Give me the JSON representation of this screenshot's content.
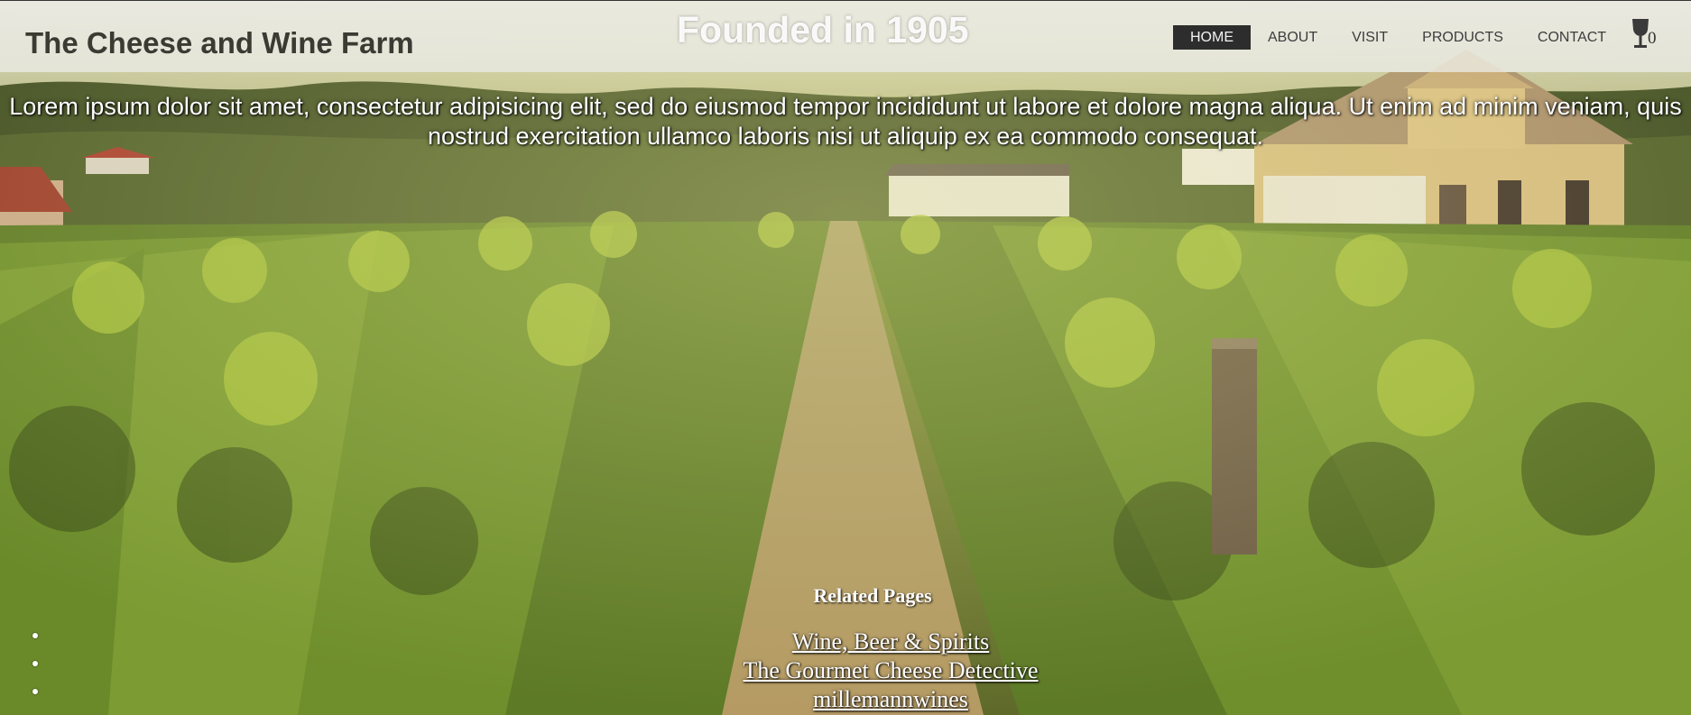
{
  "header": {
    "site_title": "The Cheese and Wine Farm",
    "tagline": "Founded in 1905",
    "nav": [
      {
        "label": "HOME",
        "active": true
      },
      {
        "label": "ABOUT",
        "active": false
      },
      {
        "label": "VISIT",
        "active": false
      },
      {
        "label": "PRODUCTS",
        "active": false
      },
      {
        "label": "CONTACT",
        "active": false
      }
    ],
    "cart": {
      "icon": "wine-glass-icon",
      "count": "0"
    }
  },
  "intro": {
    "text": "Lorem ipsum dolor sit amet, consectetur adipisicing elit, sed do eiusmod tempor incididunt ut labore et dolore magna aliqua. Ut enim ad minim veniam, quis nostrud exercitation ullamco laboris nisi ut aliquip ex ea commodo consequat."
  },
  "related": {
    "heading": "Related Pages",
    "links": [
      {
        "label": "Wine, Beer & Spirits"
      },
      {
        "label": "The Gourmet Cheese Detective"
      },
      {
        "label": "millemannwines"
      }
    ]
  },
  "colors": {
    "header_bg": "#ebebe6",
    "active_nav_bg": "#2d2d2d",
    "title_text": "#3b3a33",
    "overlay_text": "#ffffff"
  }
}
